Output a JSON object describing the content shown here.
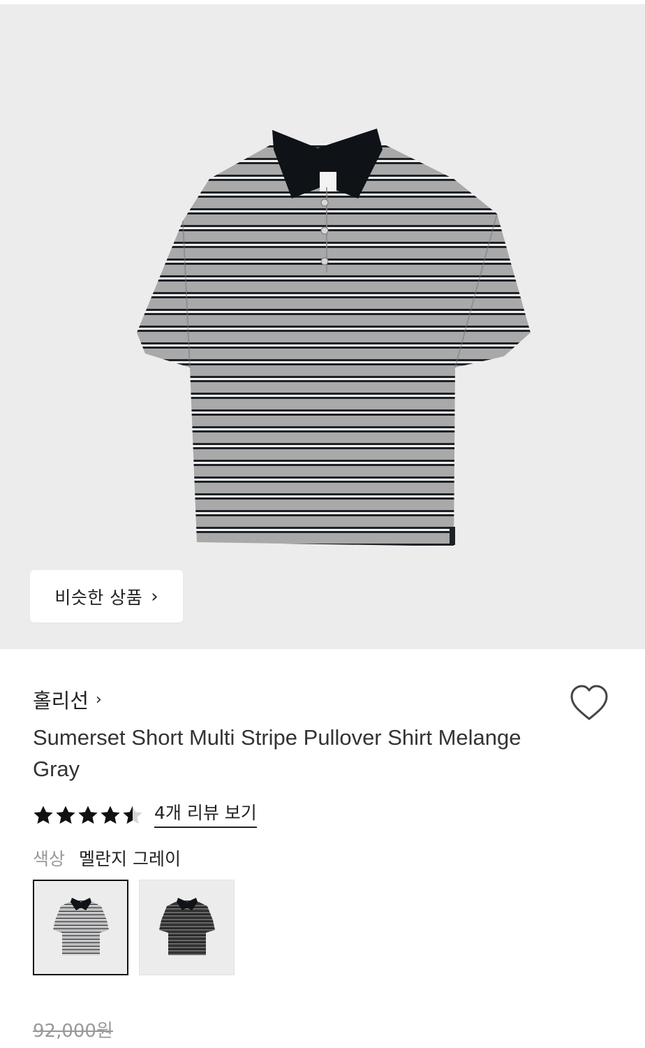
{
  "hero": {
    "similar_label": "비슷한 상품"
  },
  "product": {
    "brand": "홀리선",
    "title": "Sumerset Short Multi Stripe Pullover Shirt Melange Gray",
    "rating": 4.5,
    "rating_max": 5,
    "review_link": "4개 리뷰 보기",
    "color_key": "색상",
    "color_value": "멜란지 그레이",
    "swatches": [
      {
        "variant": "melange-gray",
        "selected": true
      },
      {
        "variant": "charcoal",
        "selected": false
      }
    ],
    "original_price": "92,000원"
  },
  "colors": {
    "hero_bg": "#ececec",
    "text": "#222222",
    "muted": "#999999"
  }
}
